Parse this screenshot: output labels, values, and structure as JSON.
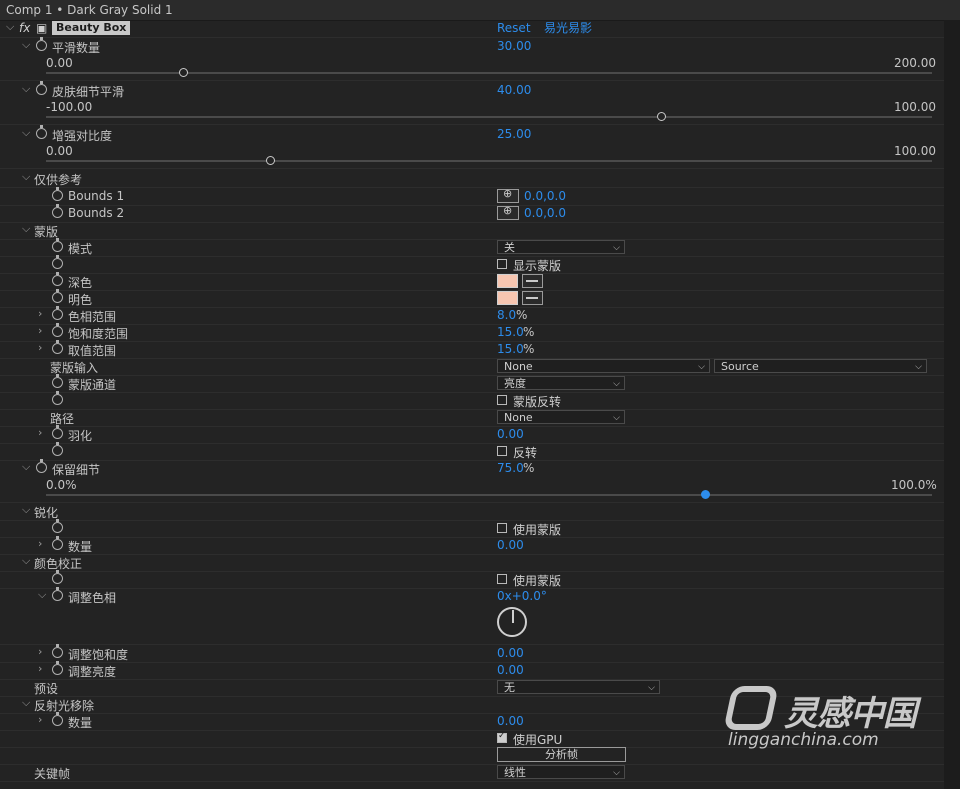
{
  "window": {
    "title": "Comp 1 • Dark Gray Solid 1"
  },
  "effect": {
    "fx": "fx",
    "name": "Beauty Box",
    "reset": "Reset",
    "credit": "易光易影"
  },
  "smooth_amount": {
    "label": "平滑数量",
    "value": "30.00",
    "min": "0.00",
    "max": "200.00",
    "fraction": 0.15
  },
  "skin_detail": {
    "label": "皮肤细节平滑",
    "value": "40.00",
    "min": "-100.00",
    "max": "100.00",
    "fraction": 0.7
  },
  "contrast": {
    "label": "增强对比度",
    "value": "25.00",
    "min": "0.00",
    "max": "100.00",
    "fraction": 0.25
  },
  "reference": {
    "label": "仅供参考",
    "bounds1": "Bounds 1",
    "bounds1_value": "0.0,0.0",
    "bounds2": "Bounds 2",
    "bounds2_value": "0.0,0.0"
  },
  "mask": {
    "label": "蒙版",
    "mode_label": "模式",
    "mode_value": "关",
    "show_mask": "显示蒙版",
    "dark_label": "深色",
    "light_label": "明色",
    "hue_range_label": "色相范围",
    "hue_range_value": "8.0",
    "hue_range_unit": "%",
    "sat_range_label": "饱和度范围",
    "sat_range_value": "15.0",
    "sat_range_unit": "%",
    "val_range_label": "取值范围",
    "val_range_value": "15.0",
    "val_range_unit": "%",
    "input_label": "蒙版输入",
    "input_value": "None",
    "input_source": "Source",
    "channel_label": "蒙版通道",
    "channel_value": "亮度",
    "invert_label": "蒙版反转",
    "path_label": "路径",
    "path_value": "None",
    "feather_label": "羽化",
    "feather_value": "0.00",
    "reverse_label": "反转"
  },
  "keep_detail": {
    "label": "保留细节",
    "value": "75.0",
    "unit": "%",
    "min": "0.0%",
    "max": "100.0%",
    "fraction": 0.75
  },
  "sharpen": {
    "label": "锐化",
    "use_mask": "使用蒙版",
    "amount_label": "数量",
    "amount_value": "0.00"
  },
  "color_correct": {
    "label": "颜色校正",
    "use_mask": "使用蒙版",
    "hue_label": "调整色相",
    "hue_value": "0x+0.0°",
    "sat_label": "调整饱和度",
    "sat_value": "0.00",
    "bright_label": "调整亮度",
    "bright_value": "0.00"
  },
  "preset": {
    "label": "预设",
    "value": "无"
  },
  "reflection": {
    "label": "反射光移除",
    "amount_label": "数量",
    "amount_value": "0.00",
    "gpu_label": "使用GPU",
    "analyze_label": "分析帧"
  },
  "keyframe": {
    "label": "关键帧",
    "value": "线性"
  },
  "watermark": {
    "brand": "灵感中国",
    "url": "lingganchina.com"
  }
}
